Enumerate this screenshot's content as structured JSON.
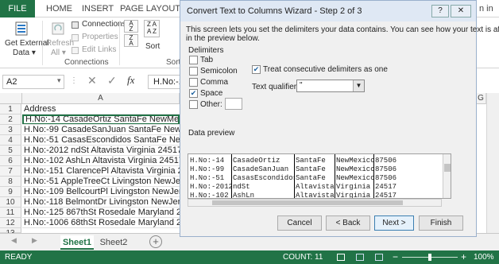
{
  "ribbon": {
    "tabs": [
      "FILE",
      "HOME",
      "INSERT",
      "PAGE LAYOUT"
    ],
    "signin_fragment": "n in",
    "get_external_data": [
      "Get External",
      "Data ▾"
    ],
    "refresh": [
      "Refresh",
      "All ▾"
    ],
    "connections": "Connections",
    "properties": "Properties",
    "edit_links": "Edit Links",
    "connections_group": "Connections",
    "sort": "Sort",
    "sort_group_fragment": "Sort"
  },
  "formula_bar": {
    "name_box": "A2",
    "fx": "fx",
    "content": "H.No:-1"
  },
  "grid": {
    "columns": [
      "A",
      "G"
    ],
    "rows": [
      "1",
      "2",
      "3",
      "4",
      "5",
      "6",
      "7",
      "8",
      "9",
      "10",
      "11",
      "12",
      "13"
    ],
    "cells": [
      "Address",
      "H.No:-14 CasadeOrtiz SantaFe NewMexic",
      "H.No:-99 CasadeSanJuan SantaFe NewM",
      "H.No:-51 CasasEscondidos SantaFe New",
      "H.No:-2012 ndSt Altavista Virginia 24517",
      "H.No:-102 AshLn Altavista Virginia 24517",
      "H.No:-151 ClarencePl Altavista Virginia 24",
      "H.No:-51 AppleTreeCt Livingston NewJers",
      "H.No:-109 BellcourtPl Livingston NewJerse",
      "H.No:-118 BelmontDr Livingston NewJersy",
      "H.No:-125 867thSt Rosedale Maryland 21",
      "H.No:-1006 68thSt Rosedale Maryland 21",
      ""
    ]
  },
  "sheets": [
    "Sheet1",
    "Sheet2"
  ],
  "status": {
    "ready": "READY",
    "count": "COUNT: 11",
    "zoom": "100%"
  },
  "dialog": {
    "title": "Convert Text to Columns Wizard - Step 2 of 3",
    "help": "?",
    "close": "✕",
    "description": [
      "This screen lets you set the delimiters your data contains.  You can see how your text is affected",
      "in the preview below."
    ],
    "delimiters_label": "Delimiters",
    "delimiters": [
      {
        "label": "Tab",
        "checked": false
      },
      {
        "label": "Semicolon",
        "checked": false
      },
      {
        "label": "Comma",
        "checked": false
      },
      {
        "label": "Space",
        "checked": true
      },
      {
        "label": "Other:",
        "checked": false
      }
    ],
    "treat_consecutive": {
      "label": "Treat consecutive delimiters as one",
      "checked": true
    },
    "text_qualifier_label": "Text qualifier:",
    "text_qualifier_value": "\"",
    "data_preview_label": "Data preview",
    "preview_rows": [
      [
        "H.No:-14",
        "CasadeOrtiz",
        "SantaFe",
        "NewMexico",
        "87506"
      ],
      [
        "H.No:-99",
        "CasadeSanJuan",
        "SantaFe",
        "NewMexico",
        "87506"
      ],
      [
        "H.No:-51",
        "CasasEscondidos",
        "SantaFe",
        "NewMexico",
        "87506"
      ],
      [
        "H.No:-2012",
        "ndSt",
        "Altavista",
        "Virginia",
        "24517"
      ],
      [
        "H.No:-102",
        "AshLn",
        "Altavista",
        "Virginia",
        "24517"
      ]
    ],
    "buttons": {
      "cancel": "Cancel",
      "back": "< Back",
      "next": "Next >",
      "finish": "Finish"
    }
  }
}
